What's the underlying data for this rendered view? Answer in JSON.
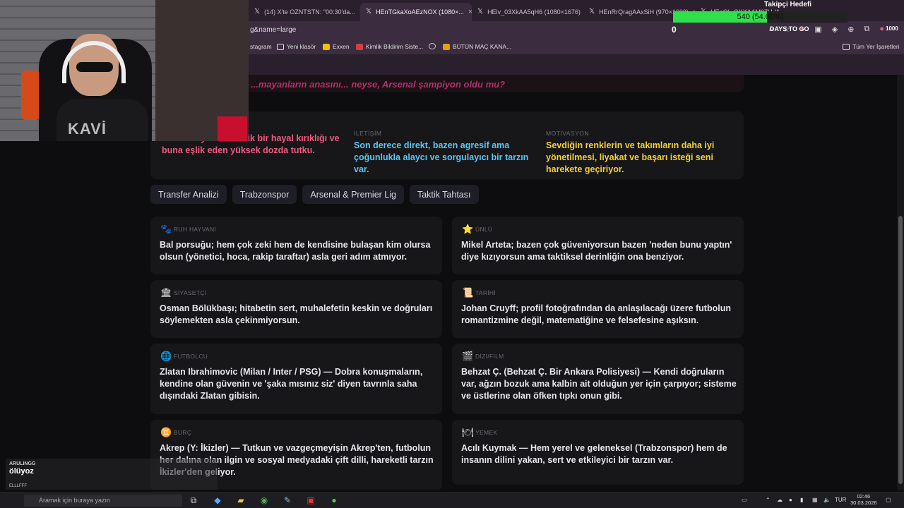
{
  "browser": {
    "tabs": [
      {
        "label": "(14) X'te OZNTSTN: \"00:30'da...",
        "icon": "x-logo-icon"
      },
      {
        "label": "HEnTGkaXoAEzNOX (1080×...",
        "icon": "x-logo-icon"
      },
      {
        "label": "HElv_03XkAA5qH6 (1080×1676)",
        "icon": "x-logo-icon"
      },
      {
        "label": "HEnRrQragAAxSiH (970×1600)",
        "icon": "x-logo-icon"
      },
      {
        "label": "HEnQL-OXXAAM07U (1080...",
        "icon": "x-logo-icon"
      }
    ],
    "url": "g&name=large",
    "bookmarks": [
      {
        "label": "stagram",
        "color": "#c13584"
      },
      {
        "label": "Yeni klasör",
        "color": "#d8b25a"
      },
      {
        "label": "Exxen",
        "color": "#f2c200"
      },
      {
        "label": "Kimlik Bildirim Siste...",
        "color": "#d04040"
      },
      {
        "label": "",
        "color": "#999999"
      },
      {
        "label": "BÜTÜN MAÇ KANA...",
        "color": "#e8a000"
      }
    ],
    "all_bookmarks": "Tüm Yer İşaretleri"
  },
  "stream": {
    "goal_title": "Takipçi Hedefi",
    "goal_text": "540 (54.00%)",
    "goal_progress": 0.54,
    "goal_count": "0",
    "days_to_go": "DAYS TO GO",
    "right_num": "1000",
    "webcam_shirt": "KAVİ",
    "chat_user": "ARULINGG",
    "chat_message": "ölüyoz",
    "chat_user2": "ELLLFFF"
  },
  "page": {
    "quote": "...mayanların anasını... neyse, Arsenal şampiyon oldu mu?",
    "info": [
      {
        "label": "",
        "text": "Futbol kaynaklı kronik bir hayal kırıklığı ve buna eşlik eden yüksek dozda tutku.",
        "color": "#f05a80"
      },
      {
        "label": "İLETİŞİM",
        "text": "Son derece direkt, bazen agresif ama çoğunlukla alaycı ve sorgulayıcı bir tarzın var.",
        "color": "#5bc6f5"
      },
      {
        "label": "MOTİVASYON",
        "text": "Sevdiğin renklerin ve takımların daha iyi yönetilmesi, liyakat ve başarı isteği seni harekete geçiriyor.",
        "color": "#f5d033"
      }
    ],
    "tabs": [
      "Transfer Analizi",
      "Trabzonspor",
      "Arsenal & Premier Lig",
      "Taktik Tahtası"
    ],
    "cards": [
      {
        "icon": "paw-icon",
        "glyph": "🐾",
        "label": "RUH HAYVANI",
        "text": "Bal porsuğu; hem çok zeki hem de kendisine bulaşan kim olursa olsun (yönetici, hoca, rakip taraftar) asla geri adım atmıyor."
      },
      {
        "icon": "star-icon",
        "glyph": "⭐",
        "label": "ÜNLÜ",
        "text": "Mikel Arteta; bazen çok güveniyorsun bazen 'neden bunu yaptın' diye kızıyorsun ama taktiksel derinliğin ona benziyor."
      },
      {
        "icon": "government-building-icon",
        "glyph": "🏛",
        "label": "SİYASETÇİ",
        "text": "Osman Bölükbaşı; hitabetin sert, muhalefetin keskin ve doğruları söylemekten asla çekinmiyorsun."
      },
      {
        "icon": "scroll-icon",
        "glyph": "📜",
        "label": "TARİHİ",
        "text": "Johan Cruyff; profil fotoğrafından da anlaşılacağı üzere futbolun romantizmine değil, matematiğine ve felsefesine aşıksın."
      },
      {
        "icon": "globe-icon",
        "glyph": "🌐",
        "label": "FUTBOLCU",
        "text": "Zlatan Ibrahimovic (Milan / Inter / PSG) — Dobra konuşmaların, kendine olan güvenin ve 'şaka mısınız siz' diyen tavrınla saha dışındaki Zlatan gibisin."
      },
      {
        "icon": "clapperboard-icon",
        "glyph": "🎬",
        "label": "DİZİ/FİLM",
        "text": "Behzat Ç. (Behzat Ç. Bir Ankara Polisiyesi) — Kendi doğruların var, ağzın bozuk ama kalbin ait olduğun yer için çarpıyor; sisteme ve üstlerine olan öfken tıpkı onun gibi."
      },
      {
        "icon": "zodiac-icon",
        "glyph": "♊",
        "label": "BURÇ",
        "text": "Akrep (Y: İkizler) — Tutkun ve vazgeçmeyişin Akrep'ten, futbolun her dalına olan ilgin ve sosyal medyadaki çift dilli, hareketli tarzın İkizler'den geliyor."
      },
      {
        "icon": "plate-icon",
        "glyph": "🍽",
        "label": "YEMEK",
        "text": "Acılı Kuymak — Hem yerel ve geleneksel (Trabzonspor) hem de insanın dilini yakan, sert ve etkileyici bir tarzın var."
      }
    ]
  },
  "taskbar": {
    "search_placeholder": "Aramak için buraya yazın",
    "lang": "TUR",
    "time": "02:46",
    "date": "30.03.2026"
  }
}
